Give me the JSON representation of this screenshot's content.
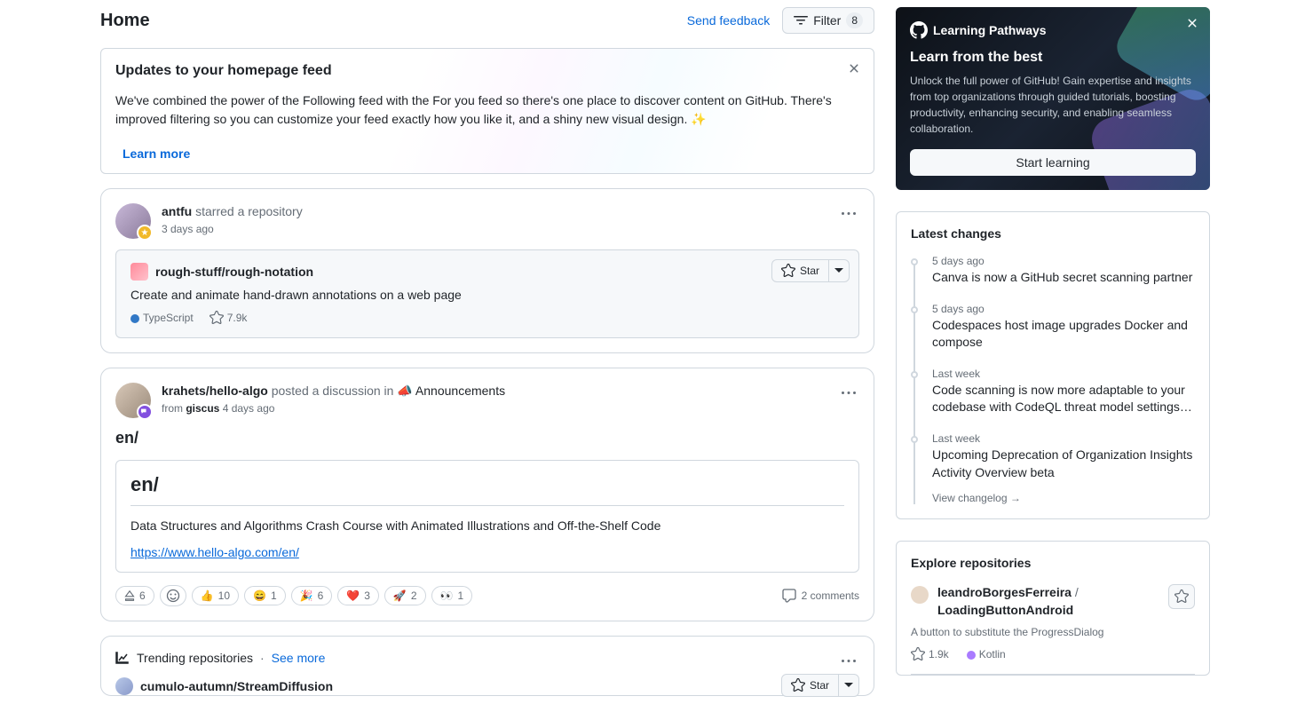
{
  "header": {
    "title": "Home",
    "feedback": "Send feedback",
    "filter_label": "Filter",
    "filter_count": "8"
  },
  "notice": {
    "title": "Updates to your homepage feed",
    "body": "We've combined the power of the Following feed with the For you feed so there's one place to discover content on GitHub. There's improved filtering so you can customize your feed exactly how you like it, and a shiny new visual design. ✨",
    "learn_more": "Learn more"
  },
  "feed": {
    "star_event": {
      "actor": "antfu",
      "action": "starred a repository",
      "time": "3 days ago",
      "repo": {
        "name": "rough-stuff/rough-notation",
        "desc": "Create and animate hand-drawn annotations on a web page",
        "lang": "TypeScript",
        "stars": "7.9k",
        "star_btn": "Star"
      }
    },
    "discussion_event": {
      "actor": "krahets/hello-algo",
      "action": "posted a discussion in",
      "category": "Announcements",
      "from_label": "from",
      "from_repo": "giscus",
      "time": "4 days ago",
      "title_outer": "en/",
      "title_inner": "en/",
      "body": "Data Structures and Algorithms Crash Course with Animated Illustrations and Off-the-Shelf Code",
      "link": "https://www.hello-algo.com/en/",
      "reactions": {
        "upvote": "6",
        "thumbs": "10",
        "grin": "1",
        "tada": "6",
        "heart": "3",
        "rocket": "2",
        "eyes": "1"
      },
      "comments": "2 comments"
    },
    "trending": {
      "label": "Trending repositories",
      "see_more": "See more",
      "repo_name": "cumulo-autumn/StreamDiffusion",
      "star_btn": "Star"
    }
  },
  "promo": {
    "logo": "Learning Pathways",
    "title": "Learn from the best",
    "body": "Unlock the full power of GitHub! Gain expertise and insights from top organizations through guided tutorials, boosting productivity, enhancing security, and enabling seamless collaboration.",
    "cta": "Start learning"
  },
  "changes": {
    "title": "Latest changes",
    "items": [
      {
        "time": "5 days ago",
        "title": "Canva is now a GitHub secret scanning partner"
      },
      {
        "time": "5 days ago",
        "title": "Codespaces host image upgrades Docker and compose"
      },
      {
        "time": "Last week",
        "title": "Code scanning is now more adaptable to your codebase with CodeQL threat model settings…"
      },
      {
        "time": "Last week",
        "title": "Upcoming Deprecation of Organization Insights Activity Overview beta"
      }
    ],
    "view_all": "View changelog →"
  },
  "explore": {
    "title": "Explore repositories",
    "item": {
      "owner": "leandroBorgesFerreira",
      "slash": " / ",
      "repo": "LoadingButtonAndroid",
      "desc": "A button to substitute the ProgressDialog",
      "stars": "1.9k",
      "lang": "Kotlin"
    }
  }
}
